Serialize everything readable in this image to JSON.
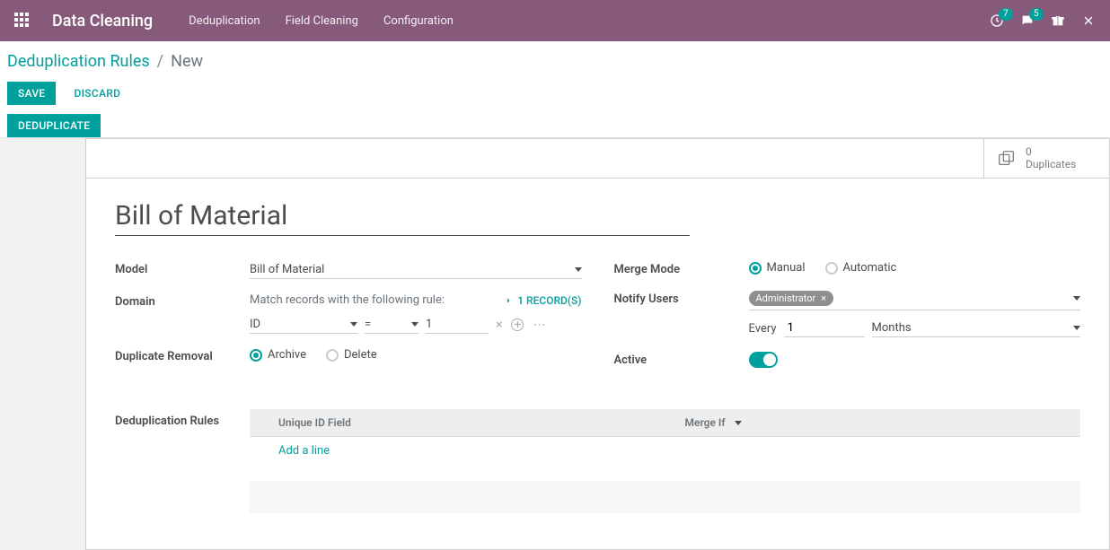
{
  "topnav": {
    "brand": "Data Cleaning",
    "items": [
      "Deduplication",
      "Field Cleaning",
      "Configuration"
    ],
    "clock_badge": "7",
    "chat_badge": "5"
  },
  "breadcrumb": {
    "root": "Deduplication Rules",
    "current": "New"
  },
  "actions": {
    "save": "SAVE",
    "discard": "DISCARD"
  },
  "tabs": {
    "deduplicate": "DEDUPLICATE"
  },
  "statbox": {
    "count": "0",
    "label": "Duplicates"
  },
  "form": {
    "title": "Bill of Material",
    "labels": {
      "model": "Model",
      "domain": "Domain",
      "duplicate_removal": "Duplicate Removal",
      "merge_mode": "Merge Mode",
      "notify_users": "Notify Users",
      "active": "Active",
      "every": "Every"
    },
    "model_value": "Bill of Material",
    "domain_summary": "Match records with the following rule:",
    "record_link": "1 RECORD(S)",
    "domain_field": "ID",
    "domain_op": "=",
    "domain_value": "1",
    "removal_options": {
      "archive": "Archive",
      "delete": "Delete"
    },
    "merge_options": {
      "manual": "Manual",
      "automatic": "Automatic"
    },
    "notify_tag": "Administrator",
    "every_value": "1",
    "every_unit": "Months"
  },
  "subtable": {
    "label": "Deduplication Rules",
    "headers": {
      "unique_id": "Unique ID Field",
      "merge_if": "Merge If"
    },
    "add_line": "Add a line"
  }
}
